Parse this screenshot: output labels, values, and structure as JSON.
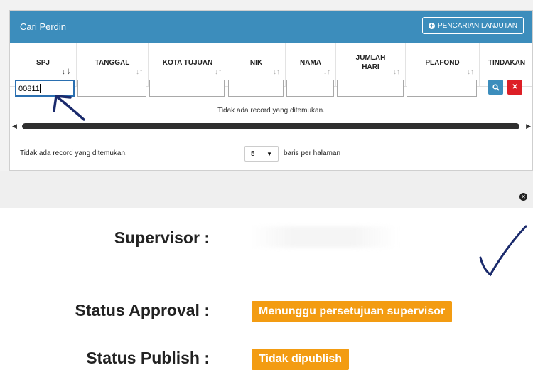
{
  "panel": {
    "title": "Cari Perdin",
    "advanced_search_label": "PENCARIAN LANJUTAN"
  },
  "table": {
    "columns": [
      "SPJ",
      "TANGGAL",
      "KOTA TUJUAN",
      "NIK",
      "NAMA",
      "JUMLAH HARI",
      "PLAFOND",
      "TINDAKAN"
    ],
    "sorted_column": "SPJ",
    "filters": {
      "spj": "00811",
      "tanggal": "",
      "kota_tujuan": "",
      "nik": "",
      "nama": "",
      "jumlah_hari": "",
      "plafond": ""
    },
    "empty_message": "Tidak ada record yang ditemukan.",
    "actions": [
      "search-icon",
      "close-icon"
    ]
  },
  "footer": {
    "info": "Tidak ada record yang ditemukan.",
    "page_size": "5",
    "page_size_suffix": "baris per halaman"
  },
  "details": {
    "supervisor_label": "Supervisor :",
    "supervisor_value": "",
    "status_approval_label": "Status Approval :",
    "status_approval_value": "Menunggu persetujuan supervisor",
    "status_publish_label": "Status Publish :",
    "status_publish_value": "Tidak dipublish"
  },
  "colors": {
    "header_blue": "#3c8dbc",
    "badge_orange": "#f39c12",
    "search_button": "#3c8dbc",
    "delete_button": "#dd1f26",
    "annotation_ink": "#1a2a6c"
  }
}
